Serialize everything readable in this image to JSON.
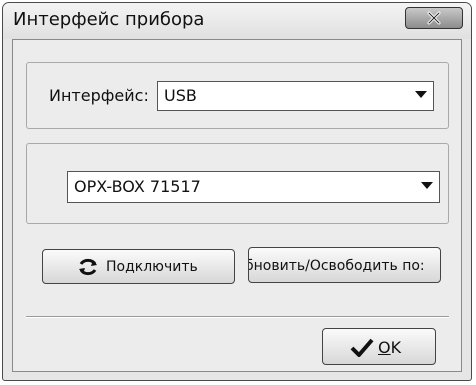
{
  "window": {
    "title": "Интерфейс прибора"
  },
  "interface_group": {
    "label": "Интерфейс:",
    "selected": "USB"
  },
  "device_group": {
    "selected": "OPX-BOX 71517"
  },
  "buttons": {
    "connect_label": "Подключить",
    "refresh_label": "бновить/Освободить по:",
    "ok_label": "OK"
  },
  "icons": {
    "close": "close-x-icon",
    "connect": "refresh-arrows-icon",
    "ok": "checkmark-icon"
  }
}
